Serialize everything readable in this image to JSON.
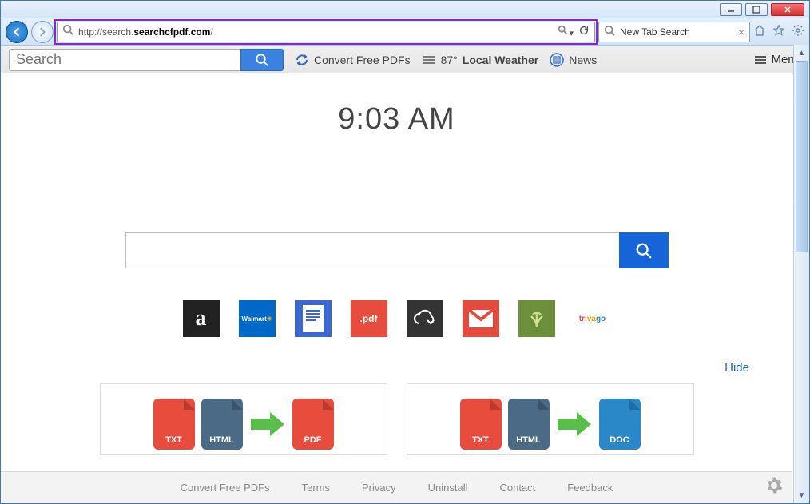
{
  "window": {
    "tab_title": "New Tab Search"
  },
  "address": {
    "url_prefix": "http://search.",
    "url_bold": "searchcfpdf.com",
    "url_suffix": "/"
  },
  "toolbar": {
    "search_placeholder": "Search",
    "convert_label": "Convert Free PDFs",
    "weather_temp": "87°",
    "weather_label": "Local Weather",
    "news_label": "News",
    "menu_label": "Menu"
  },
  "page": {
    "clock": "9:03 AM",
    "hide_label": "Hide"
  },
  "tiles": {
    "amazon": "a",
    "walmart": "Walmart",
    "pdf": ".pdf",
    "trivago": "trivago"
  },
  "ads": {
    "txt": "TXT",
    "html": "HTML",
    "pdf": "PDF",
    "doc": "DOC"
  },
  "footer": {
    "links": [
      "Convert Free PDFs",
      "Terms",
      "Privacy",
      "Uninstall",
      "Contact",
      "Feedback"
    ]
  }
}
